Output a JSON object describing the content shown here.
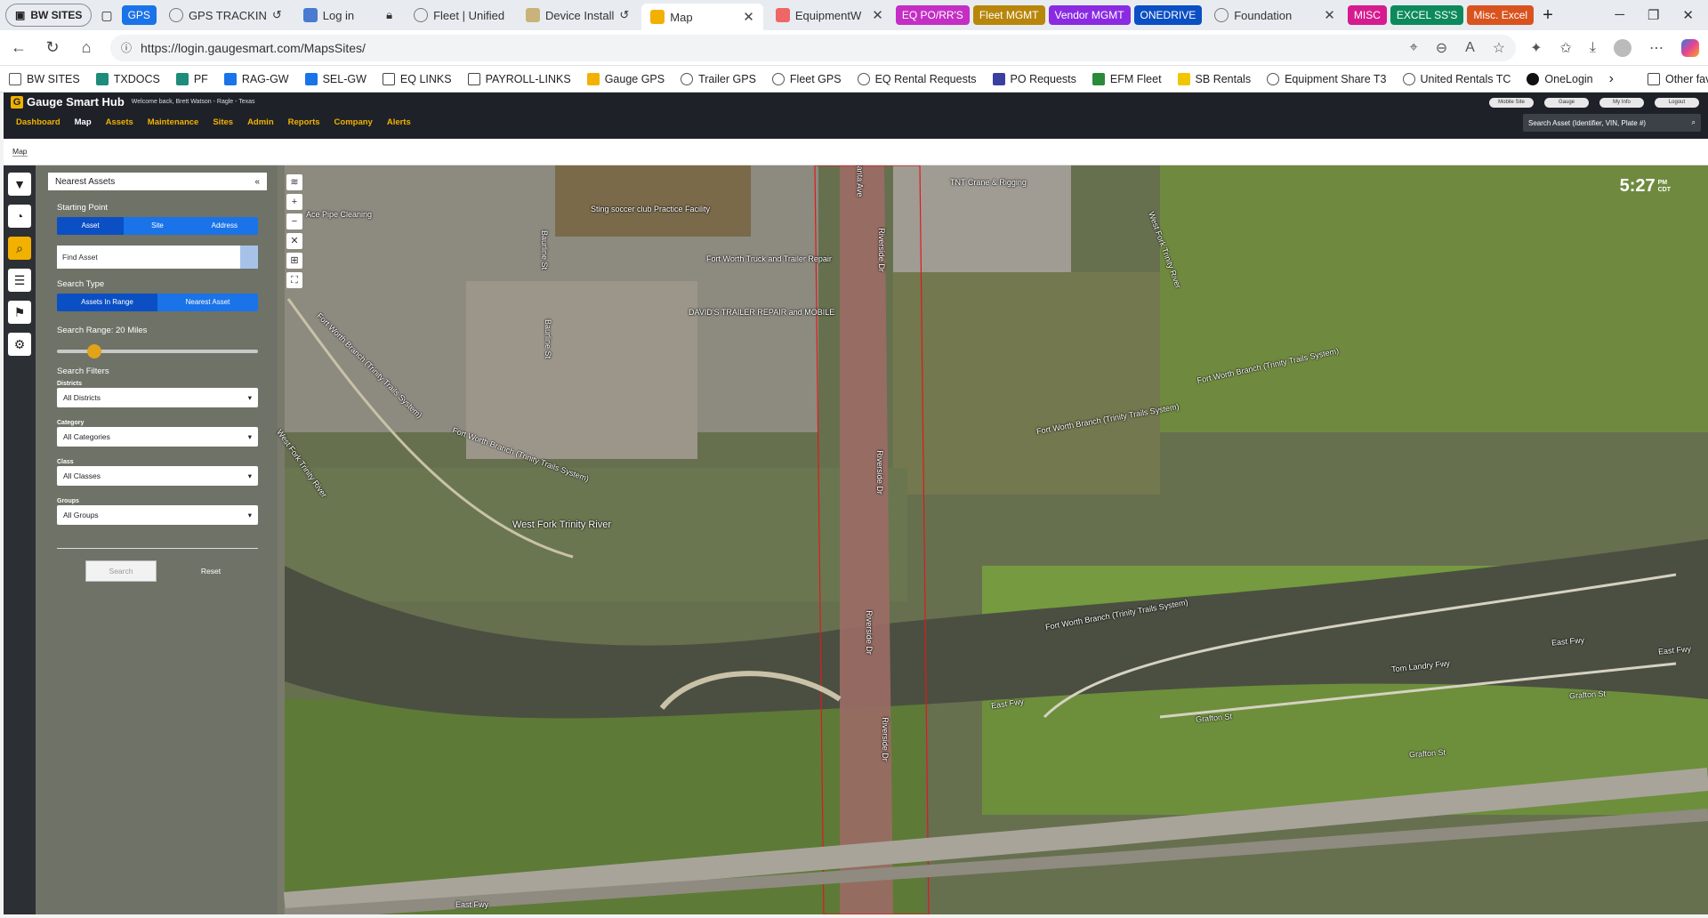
{
  "browser": {
    "workspace_label": "BW SITES",
    "tabs": [
      {
        "label": "GPS",
        "type": "group",
        "color": "#1a73e8"
      },
      {
        "label": "GPS TRACKIN",
        "type": "tab"
      },
      {
        "label": "Log in",
        "type": "tab"
      },
      {
        "label": "Fleet | Unified",
        "type": "tab"
      },
      {
        "label": "Device Install",
        "type": "tab"
      },
      {
        "label": "Map",
        "type": "tab",
        "active": true
      },
      {
        "label": "EquipmentW",
        "type": "tab"
      },
      {
        "label": "EQ PO/RR'S",
        "type": "group",
        "color": "#c42ec4"
      },
      {
        "label": "Fleet MGMT",
        "type": "group",
        "color": "#b8860b"
      },
      {
        "label": "Vendor MGMT",
        "type": "group",
        "color": "#8a2be2"
      },
      {
        "label": "ONEDRIVE",
        "type": "group",
        "color": "#0b4fc4"
      },
      {
        "label": "Foundation",
        "type": "tab"
      },
      {
        "label": "MISC",
        "type": "group",
        "color": "#d61b8f"
      },
      {
        "label": "EXCEL SS'S",
        "type": "group",
        "color": "#0c8a5c"
      },
      {
        "label": "Misc. Excel",
        "type": "group",
        "color": "#d9531e"
      }
    ],
    "url": "https://login.gaugesmart.com/MapsSites/",
    "favorites": [
      "BW SITES",
      "TXDOCS",
      "PF",
      "RAG-GW",
      "SEL-GW",
      "EQ LINKS",
      "PAYROLL-LINKS",
      "Gauge GPS",
      "Trailer GPS",
      "Fleet GPS",
      "EQ Rental Requests",
      "PO Requests",
      "EFM Fleet",
      "SB Rentals",
      "Equipment Share T3",
      "United Rentals TC",
      "OneLogin"
    ],
    "other_favorites": "Other favorites"
  },
  "app": {
    "title": "Gauge Smart Hub",
    "welcome": "Welcome back, Brett Watson - Ragle - Texas",
    "nav": [
      "Dashboard",
      "Map",
      "Assets",
      "Maintenance",
      "Sites",
      "Admin",
      "Reports",
      "Company",
      "Alerts"
    ],
    "active_nav": "Map",
    "header_buttons": [
      "Mobile Site",
      "Gauge",
      "My Info",
      "Logout"
    ],
    "search_placeholder": "Search Asset (Identifier, VIN, Plate #)",
    "subnav": "Map"
  },
  "panel": {
    "title": "Nearest Assets",
    "collapse": "«",
    "starting_point_label": "Starting Point",
    "starting_point_options": [
      "Asset",
      "Site",
      "Address"
    ],
    "find_asset": "Find Asset",
    "search_type_label": "Search Type",
    "search_type_options": [
      "Assets In Range",
      "Nearest Asset"
    ],
    "range_label": "Search Range: 20 Miles",
    "range_value_miles": 20,
    "filters_label": "Search Filters",
    "filters": [
      {
        "label": "Districts",
        "value": "All Districts"
      },
      {
        "label": "Category",
        "value": "All Categories"
      },
      {
        "label": "Class",
        "value": "All Classes"
      },
      {
        "label": "Groups",
        "value": "All Groups"
      }
    ],
    "search_button": "Search",
    "reset_button": "Reset"
  },
  "map": {
    "time": "5:27",
    "ampm": "PM",
    "tz": "CDT",
    "labels": [
      "Riverside Dr",
      "Riverside Dr",
      "Riverside Dr",
      "Riverside Dr",
      "Santa Ave",
      "Sting soccer club Practice Facility",
      "Fort Worth Truck and Trailer Repair",
      "DAVID'S TRAILER REPAIR and MOBILE",
      "TNT Crane & Rigging",
      "Ace Pipe Cleaning",
      "Baurline St",
      "Baurline St",
      "West Fork Trinity River",
      "West Fork Trinity River",
      "West Fork Trinity River",
      "Fort Worth Branch (Trinity Trails System)",
      "Fort Worth Branch (Trinity Trails System)",
      "Fort Worth Branch (Trinity Trails System)",
      "Fort Worth Branch (Trinity Trails System)",
      "Fort Worth Branch (Trinity Trails System)",
      "East Fwy",
      "East Fwy",
      "East Fwy",
      "East Fwy",
      "Tom Landry Fwy",
      "Grafton St",
      "Grafton St",
      "Grafton St"
    ]
  }
}
